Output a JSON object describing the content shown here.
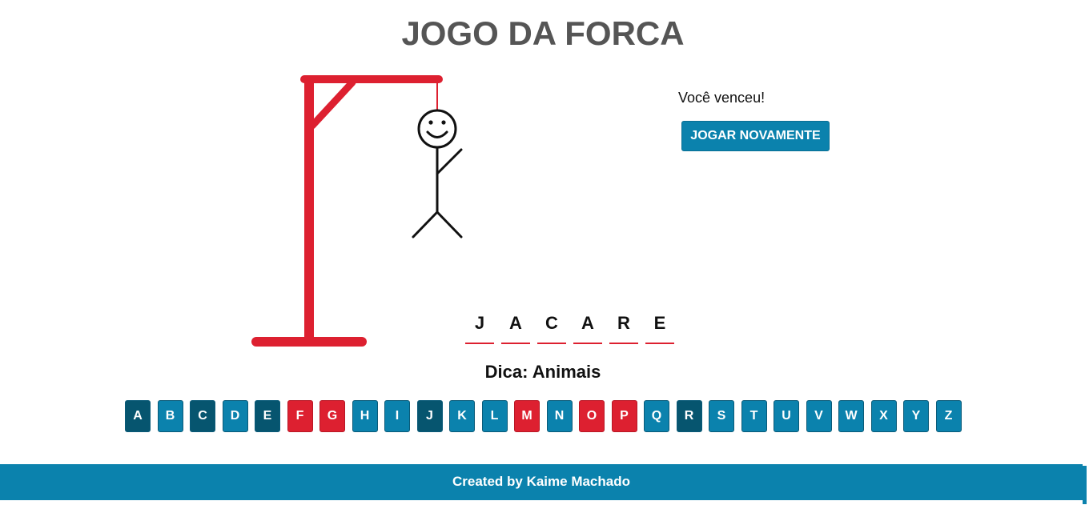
{
  "title": "JOGO DA FORCA",
  "status": "Você venceu!",
  "play_again_label": "JOGAR NOVAMENTE",
  "word": [
    "J",
    "A",
    "C",
    "A",
    "R",
    "E"
  ],
  "hint": "Dica: Animais",
  "keyboard": [
    {
      "letter": "A",
      "state": "hit"
    },
    {
      "letter": "B",
      "state": "unused"
    },
    {
      "letter": "C",
      "state": "hit"
    },
    {
      "letter": "D",
      "state": "unused"
    },
    {
      "letter": "E",
      "state": "hit"
    },
    {
      "letter": "F",
      "state": "miss"
    },
    {
      "letter": "G",
      "state": "miss"
    },
    {
      "letter": "H",
      "state": "unused"
    },
    {
      "letter": "I",
      "state": "unused"
    },
    {
      "letter": "J",
      "state": "hit"
    },
    {
      "letter": "K",
      "state": "unused"
    },
    {
      "letter": "L",
      "state": "unused"
    },
    {
      "letter": "M",
      "state": "miss"
    },
    {
      "letter": "N",
      "state": "unused"
    },
    {
      "letter": "O",
      "state": "miss"
    },
    {
      "letter": "P",
      "state": "miss"
    },
    {
      "letter": "Q",
      "state": "unused"
    },
    {
      "letter": "R",
      "state": "hit"
    },
    {
      "letter": "S",
      "state": "unused"
    },
    {
      "letter": "T",
      "state": "unused"
    },
    {
      "letter": "U",
      "state": "unused"
    },
    {
      "letter": "V",
      "state": "unused"
    },
    {
      "letter": "W",
      "state": "unused"
    },
    {
      "letter": "X",
      "state": "unused"
    },
    {
      "letter": "Y",
      "state": "unused"
    },
    {
      "letter": "Z",
      "state": "unused"
    }
  ],
  "footer": "Created by Kaime Machado",
  "colors": {
    "accent": "#0b82ad",
    "hit": "#06556f",
    "miss": "#dd2030",
    "gallows": "#dd2030",
    "title": "#555555"
  }
}
